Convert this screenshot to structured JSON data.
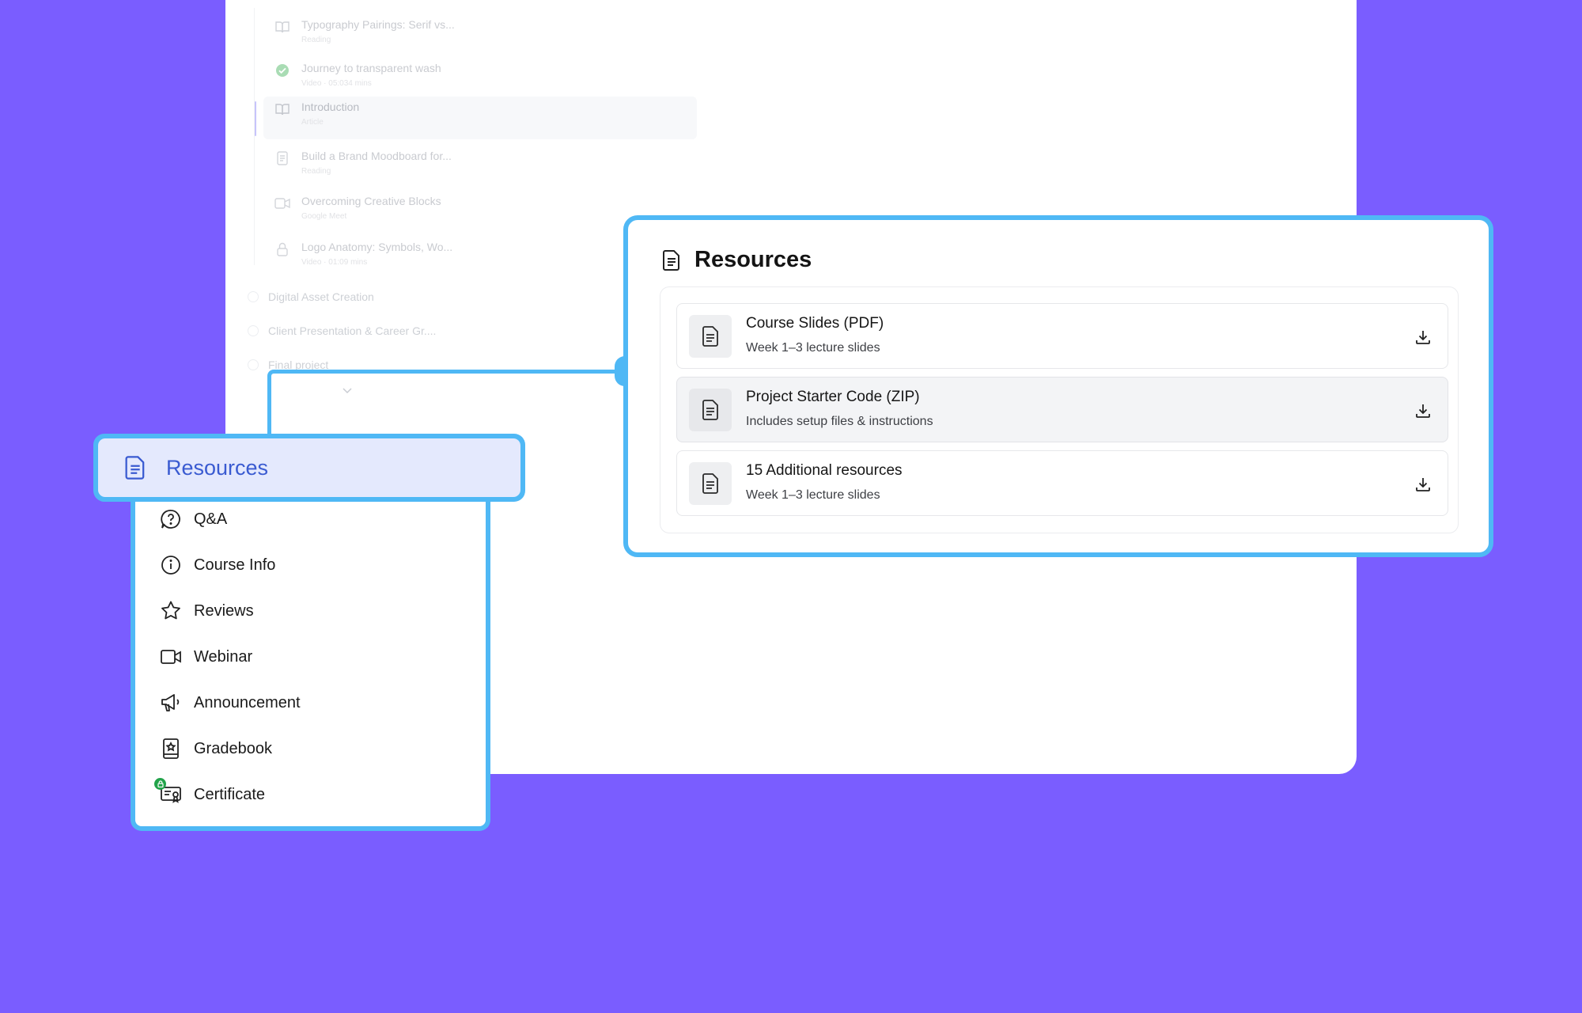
{
  "course_outline": {
    "lessons": [
      {
        "title": "Typography Pairings: Serif vs...",
        "subtitle": "Reading",
        "icon": "book-icon"
      },
      {
        "title": "Journey to transparent wash",
        "subtitle": "Video · 05:034 mins",
        "icon": "check-circle-icon"
      },
      {
        "title": "Introduction",
        "subtitle": "Article",
        "icon": "book-icon"
      },
      {
        "title": "Build a Brand Moodboard for...",
        "subtitle": "Reading",
        "icon": "document-icon"
      },
      {
        "title": "Overcoming Creative Blocks",
        "subtitle": "Google Meet",
        "icon": "video-icon"
      },
      {
        "title": "Logo Anatomy: Symbols, Wo...",
        "subtitle": "Video · 01:09 mins",
        "icon": "lock-icon"
      }
    ],
    "sections": [
      {
        "title": "Digital Asset Creation"
      },
      {
        "title": "Client Presentation & Career Gr...."
      },
      {
        "title": "Final project"
      }
    ]
  },
  "resources": {
    "title": "Resources",
    "items": [
      {
        "title": "Course Slides (PDF)",
        "subtitle": "Week 1–3 lecture slides"
      },
      {
        "title": "Project Starter Code (ZIP)",
        "subtitle": "Includes setup files & instructions"
      },
      {
        "title": "15 Additional resources",
        "subtitle": "Week 1–3 lecture slides"
      }
    ]
  },
  "menu": {
    "active": "Resources",
    "items": [
      {
        "label": "Q&A",
        "icon": "question-icon"
      },
      {
        "label": "Course Info",
        "icon": "info-icon"
      },
      {
        "label": "Reviews",
        "icon": "star-icon"
      },
      {
        "label": "Webinar",
        "icon": "video-camera-icon"
      },
      {
        "label": "Announcement",
        "icon": "megaphone-icon"
      },
      {
        "label": "Gradebook",
        "icon": "gradebook-icon"
      },
      {
        "label": "Certificate",
        "icon": "certificate-icon"
      }
    ]
  },
  "colors": {
    "background": "#7a5dff",
    "highlight_border": "#4fb8f5",
    "active_text": "#3a5bd1",
    "active_bg": "#e4e9fd"
  }
}
